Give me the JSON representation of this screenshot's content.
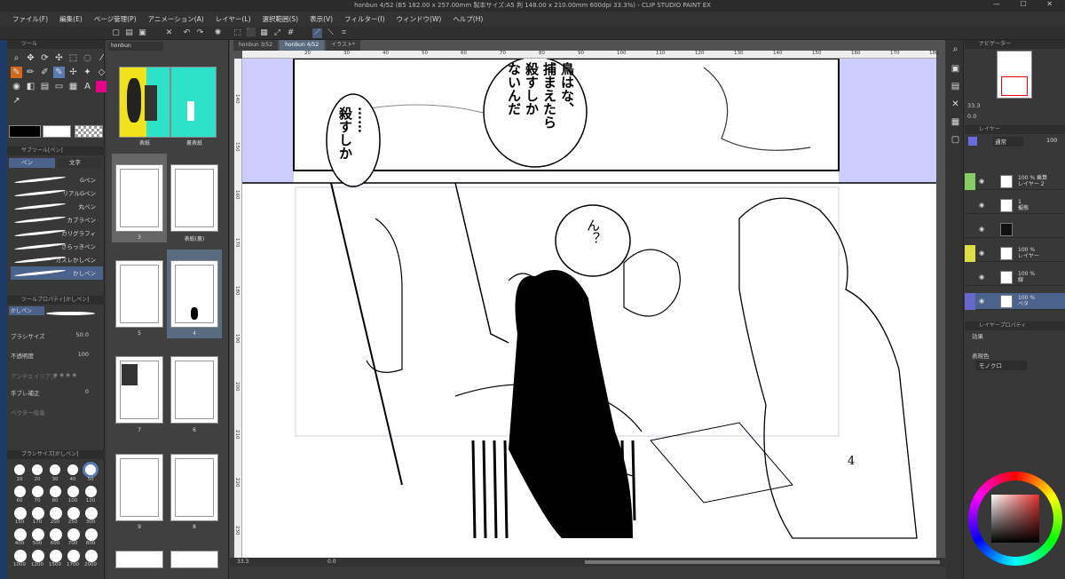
{
  "titlebar": {
    "title": "honbun 4/52 (B5 182.00 x 257.00mm 製本サイズ:A5 判 148.00 x 210.00mm 600dpi 33.3%) - CLIP STUDIO PAINT EX",
    "controls": "— ☐ ✕"
  },
  "menu": [
    "ファイル(F)",
    "編集(E)",
    "ページ管理(P)",
    "アニメーション(A)",
    "レイヤー(L)",
    "選択範囲(S)",
    "表示(V)",
    "フィルター(I)",
    "ウィンドウ(W)",
    "ヘルプ(H)"
  ],
  "tool_panel": {
    "header": "ツール",
    "subtool_header": "サブツール[ペン]",
    "tab_pen": "ペン",
    "tab_text": "文字",
    "brushes": [
      "Gペン",
      "リアルGペン",
      "丸ペン",
      "カブラペン",
      "カリグラフィ",
      "さらっきペン",
      "カスレかしペン",
      "かしペン"
    ],
    "prop_header": "ツールプロパティ[かしペン]",
    "prop_name": "かしペン",
    "brush_size_label": "ブラシサイズ",
    "brush_size_value": "50.0",
    "opacity_label": "不透明度",
    "opacity_value": "100",
    "antialias_label": "アンチエイリアス",
    "stabilize_label": "手ブレ補正",
    "stabilize_value": "0",
    "vector_label": "ベクター吸着",
    "size_header": "ブラシサイズ[かしペン]",
    "sizes": [
      "10",
      "20",
      "30",
      "40",
      "50",
      "60",
      "70",
      "80",
      "100",
      "120",
      "150",
      "170",
      "200",
      "250",
      "300",
      "400",
      "500",
      "600",
      "700",
      "800",
      "1000",
      "1200",
      "1500",
      "1700",
      "2000"
    ]
  },
  "page_panel": {
    "tab": "honbun",
    "pages": [
      {
        "label": "表紙"
      },
      {
        "label": "裏表紙"
      },
      {
        "label": "3"
      },
      {
        "label": "表紙(裏)"
      },
      {
        "label": "5"
      },
      {
        "label": "4"
      },
      {
        "label": "7"
      },
      {
        "label": "6"
      },
      {
        "label": "9"
      },
      {
        "label": "8"
      }
    ]
  },
  "canvas": {
    "tabs": [
      "honbun 3/52",
      "honbun 4/52",
      "イラスト*"
    ],
    "bubble1": [
      "鳥はな、",
      "捕まえたら",
      "殺すしか",
      "ないんだ"
    ],
    "bubble2": [
      "……",
      "殺すしか"
    ],
    "bubble3": [
      "ん？"
    ],
    "page_number": "4",
    "ruler_h": [
      "20",
      "30",
      "40",
      "50",
      "60",
      "70",
      "80",
      "90",
      "100",
      "110",
      "120",
      "130",
      "140",
      "150",
      "160",
      "170",
      "180"
    ],
    "ruler_v": [
      "140",
      "150",
      "160",
      "170",
      "180",
      "190",
      "200",
      "210",
      "220",
      "230"
    ],
    "zoom": "33.3",
    "angle": "0.0"
  },
  "right_panel": {
    "nav_header": "ナビゲーター",
    "zoom": "33.3",
    "angle": "0.0",
    "layer_header": "レイヤー",
    "blend_mode": "通常",
    "opacity": "100",
    "layers": [
      {
        "text": "100 % 乗算\nレイヤー 2",
        "color": "#88cc66",
        "thumb": "light"
      },
      {
        "text": "1\n擬態",
        "color": "",
        "thumb": "light"
      },
      {
        "text": "",
        "color": "",
        "thumb": "dark"
      },
      {
        "text": "100 %\nレイヤー",
        "color": "#dddd44",
        "thumb": "light"
      },
      {
        "text": "100 %\n線",
        "color": "",
        "thumb": "light"
      },
      {
        "text": "100 %\nペタ",
        "color": "#6666cc",
        "thumb": "light"
      }
    ],
    "layer_prop_header": "レイヤープロパティ",
    "effect_label": "効果",
    "expression_label": "表現色",
    "expression_value": "モノクロ"
  },
  "colors": {
    "accent": "#5a7bb0",
    "margin": "#ccccff"
  }
}
